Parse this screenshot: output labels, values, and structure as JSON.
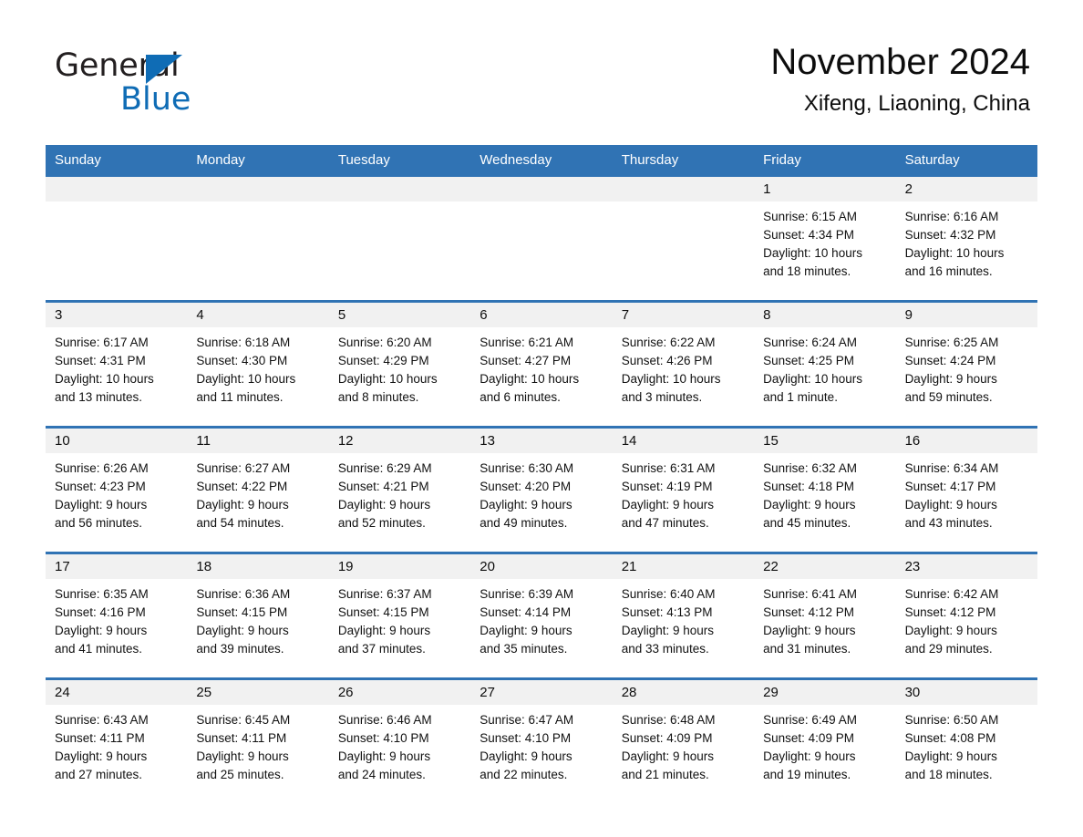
{
  "brand": {
    "name_part1": "General",
    "name_part2": "Blue",
    "triangle_color": "#0f6cb5"
  },
  "header": {
    "title": "November 2024",
    "subtitle": "Xifeng, Liaoning, China"
  },
  "theme": {
    "header_blue": "#3073b4",
    "row_separator_blue": "#3073b4",
    "day_band_gray": "#f1f1f1",
    "text_color": "#111111"
  },
  "weekdays": [
    "Sunday",
    "Monday",
    "Tuesday",
    "Wednesday",
    "Thursday",
    "Friday",
    "Saturday"
  ],
  "weeks": [
    [
      {
        "day": "",
        "sunrise": "",
        "sunset": "",
        "daylight1": "",
        "daylight2": ""
      },
      {
        "day": "",
        "sunrise": "",
        "sunset": "",
        "daylight1": "",
        "daylight2": ""
      },
      {
        "day": "",
        "sunrise": "",
        "sunset": "",
        "daylight1": "",
        "daylight2": ""
      },
      {
        "day": "",
        "sunrise": "",
        "sunset": "",
        "daylight1": "",
        "daylight2": ""
      },
      {
        "day": "",
        "sunrise": "",
        "sunset": "",
        "daylight1": "",
        "daylight2": ""
      },
      {
        "day": "1",
        "sunrise": "Sunrise: 6:15 AM",
        "sunset": "Sunset: 4:34 PM",
        "daylight1": "Daylight: 10 hours",
        "daylight2": "and 18 minutes."
      },
      {
        "day": "2",
        "sunrise": "Sunrise: 6:16 AM",
        "sunset": "Sunset: 4:32 PM",
        "daylight1": "Daylight: 10 hours",
        "daylight2": "and 16 minutes."
      }
    ],
    [
      {
        "day": "3",
        "sunrise": "Sunrise: 6:17 AM",
        "sunset": "Sunset: 4:31 PM",
        "daylight1": "Daylight: 10 hours",
        "daylight2": "and 13 minutes."
      },
      {
        "day": "4",
        "sunrise": "Sunrise: 6:18 AM",
        "sunset": "Sunset: 4:30 PM",
        "daylight1": "Daylight: 10 hours",
        "daylight2": "and 11 minutes."
      },
      {
        "day": "5",
        "sunrise": "Sunrise: 6:20 AM",
        "sunset": "Sunset: 4:29 PM",
        "daylight1": "Daylight: 10 hours",
        "daylight2": "and 8 minutes."
      },
      {
        "day": "6",
        "sunrise": "Sunrise: 6:21 AM",
        "sunset": "Sunset: 4:27 PM",
        "daylight1": "Daylight: 10 hours",
        "daylight2": "and 6 minutes."
      },
      {
        "day": "7",
        "sunrise": "Sunrise: 6:22 AM",
        "sunset": "Sunset: 4:26 PM",
        "daylight1": "Daylight: 10 hours",
        "daylight2": "and 3 minutes."
      },
      {
        "day": "8",
        "sunrise": "Sunrise: 6:24 AM",
        "sunset": "Sunset: 4:25 PM",
        "daylight1": "Daylight: 10 hours",
        "daylight2": "and 1 minute."
      },
      {
        "day": "9",
        "sunrise": "Sunrise: 6:25 AM",
        "sunset": "Sunset: 4:24 PM",
        "daylight1": "Daylight: 9 hours",
        "daylight2": "and 59 minutes."
      }
    ],
    [
      {
        "day": "10",
        "sunrise": "Sunrise: 6:26 AM",
        "sunset": "Sunset: 4:23 PM",
        "daylight1": "Daylight: 9 hours",
        "daylight2": "and 56 minutes."
      },
      {
        "day": "11",
        "sunrise": "Sunrise: 6:27 AM",
        "sunset": "Sunset: 4:22 PM",
        "daylight1": "Daylight: 9 hours",
        "daylight2": "and 54 minutes."
      },
      {
        "day": "12",
        "sunrise": "Sunrise: 6:29 AM",
        "sunset": "Sunset: 4:21 PM",
        "daylight1": "Daylight: 9 hours",
        "daylight2": "and 52 minutes."
      },
      {
        "day": "13",
        "sunrise": "Sunrise: 6:30 AM",
        "sunset": "Sunset: 4:20 PM",
        "daylight1": "Daylight: 9 hours",
        "daylight2": "and 49 minutes."
      },
      {
        "day": "14",
        "sunrise": "Sunrise: 6:31 AM",
        "sunset": "Sunset: 4:19 PM",
        "daylight1": "Daylight: 9 hours",
        "daylight2": "and 47 minutes."
      },
      {
        "day": "15",
        "sunrise": "Sunrise: 6:32 AM",
        "sunset": "Sunset: 4:18 PM",
        "daylight1": "Daylight: 9 hours",
        "daylight2": "and 45 minutes."
      },
      {
        "day": "16",
        "sunrise": "Sunrise: 6:34 AM",
        "sunset": "Sunset: 4:17 PM",
        "daylight1": "Daylight: 9 hours",
        "daylight2": "and 43 minutes."
      }
    ],
    [
      {
        "day": "17",
        "sunrise": "Sunrise: 6:35 AM",
        "sunset": "Sunset: 4:16 PM",
        "daylight1": "Daylight: 9 hours",
        "daylight2": "and 41 minutes."
      },
      {
        "day": "18",
        "sunrise": "Sunrise: 6:36 AM",
        "sunset": "Sunset: 4:15 PM",
        "daylight1": "Daylight: 9 hours",
        "daylight2": "and 39 minutes."
      },
      {
        "day": "19",
        "sunrise": "Sunrise: 6:37 AM",
        "sunset": "Sunset: 4:15 PM",
        "daylight1": "Daylight: 9 hours",
        "daylight2": "and 37 minutes."
      },
      {
        "day": "20",
        "sunrise": "Sunrise: 6:39 AM",
        "sunset": "Sunset: 4:14 PM",
        "daylight1": "Daylight: 9 hours",
        "daylight2": "and 35 minutes."
      },
      {
        "day": "21",
        "sunrise": "Sunrise: 6:40 AM",
        "sunset": "Sunset: 4:13 PM",
        "daylight1": "Daylight: 9 hours",
        "daylight2": "and 33 minutes."
      },
      {
        "day": "22",
        "sunrise": "Sunrise: 6:41 AM",
        "sunset": "Sunset: 4:12 PM",
        "daylight1": "Daylight: 9 hours",
        "daylight2": "and 31 minutes."
      },
      {
        "day": "23",
        "sunrise": "Sunrise: 6:42 AM",
        "sunset": "Sunset: 4:12 PM",
        "daylight1": "Daylight: 9 hours",
        "daylight2": "and 29 minutes."
      }
    ],
    [
      {
        "day": "24",
        "sunrise": "Sunrise: 6:43 AM",
        "sunset": "Sunset: 4:11 PM",
        "daylight1": "Daylight: 9 hours",
        "daylight2": "and 27 minutes."
      },
      {
        "day": "25",
        "sunrise": "Sunrise: 6:45 AM",
        "sunset": "Sunset: 4:11 PM",
        "daylight1": "Daylight: 9 hours",
        "daylight2": "and 25 minutes."
      },
      {
        "day": "26",
        "sunrise": "Sunrise: 6:46 AM",
        "sunset": "Sunset: 4:10 PM",
        "daylight1": "Daylight: 9 hours",
        "daylight2": "and 24 minutes."
      },
      {
        "day": "27",
        "sunrise": "Sunrise: 6:47 AM",
        "sunset": "Sunset: 4:10 PM",
        "daylight1": "Daylight: 9 hours",
        "daylight2": "and 22 minutes."
      },
      {
        "day": "28",
        "sunrise": "Sunrise: 6:48 AM",
        "sunset": "Sunset: 4:09 PM",
        "daylight1": "Daylight: 9 hours",
        "daylight2": "and 21 minutes."
      },
      {
        "day": "29",
        "sunrise": "Sunrise: 6:49 AM",
        "sunset": "Sunset: 4:09 PM",
        "daylight1": "Daylight: 9 hours",
        "daylight2": "and 19 minutes."
      },
      {
        "day": "30",
        "sunrise": "Sunrise: 6:50 AM",
        "sunset": "Sunset: 4:08 PM",
        "daylight1": "Daylight: 9 hours",
        "daylight2": "and 18 minutes."
      }
    ]
  ]
}
